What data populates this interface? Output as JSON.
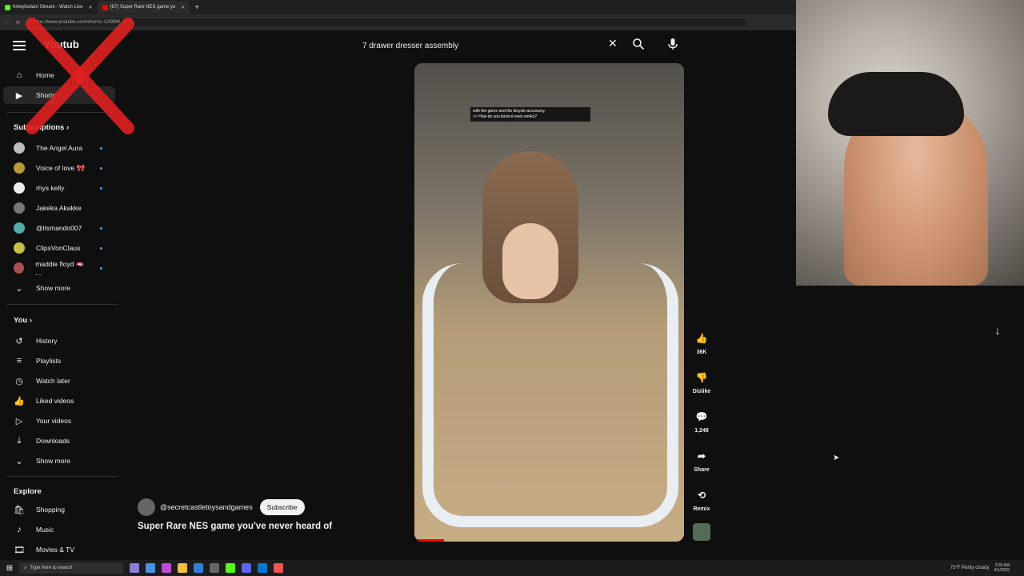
{
  "browser": {
    "tabs": [
      {
        "label": "hiheyitsdani Stream - Watch Live",
        "color": "#53fc18"
      },
      {
        "label": "(67) Super Rare NES game yo",
        "color": "#ff0000"
      }
    ],
    "url": "https://www.youtube.com/shorts/-1Jr99W_xg"
  },
  "header": {
    "logo": "Youtub",
    "search_value": "7 drawer dresser assembly"
  },
  "sidebar": {
    "top": [
      {
        "label": "Home",
        "icon": "home-icon"
      },
      {
        "label": "Shorts",
        "icon": "shorts-icon"
      }
    ],
    "subscriptions_title": "Subscriptions",
    "subscriptions": [
      {
        "label": "The Angel Aura",
        "color": "#bdbdbd"
      },
      {
        "label": "Voice of love 🎀",
        "color": "#b89a3a"
      },
      {
        "label": "rhys kelly",
        "color": "#eeeeee"
      },
      {
        "label": "Jakeka Akakke",
        "color": "#777777"
      },
      {
        "label": "@itsmando007",
        "color": "#5aa"
      },
      {
        "label": "ClipsVonClaus",
        "color": "#c9c04a"
      },
      {
        "label": "maddie floyd 🫦 ...",
        "color": "#a85050"
      }
    ],
    "show_more": "Show more",
    "you_title": "You",
    "you_items": [
      {
        "label": "History",
        "icon": "history-icon"
      },
      {
        "label": "Playlists",
        "icon": "playlists-icon"
      },
      {
        "label": "Watch later",
        "icon": "watch-later-icon"
      },
      {
        "label": "Liked videos",
        "icon": "like-icon"
      },
      {
        "label": "Your videos",
        "icon": "play-icon"
      },
      {
        "label": "Downloads",
        "icon": "download-icon"
      }
    ],
    "show_more_2": "Show more",
    "explore_title": "Explore",
    "explore_items": [
      {
        "label": "Shopping",
        "icon": "shopping-icon"
      },
      {
        "label": "Music",
        "icon": "music-icon"
      },
      {
        "label": "Movies & TV",
        "icon": "movies-icon"
      }
    ]
  },
  "video": {
    "caption_line1": "with the game and the bicycle accessory.",
    "caption_line2": ">> How do you know it even works?",
    "progress": 0.11
  },
  "actions": {
    "likes": "36K",
    "dislike": "Dislike",
    "comments": "1,248",
    "share": "Share",
    "remix": "Remix"
  },
  "channel": {
    "handle": "@secretcastletoysandgames",
    "subscribe": "Subscribe",
    "title": "Super Rare NES game you've never heard of"
  },
  "taskbar": {
    "search_placeholder": "Type here to search",
    "weather": "73°F  Partly cloudy",
    "time": "2:00 AM",
    "date": "4/1/2025"
  }
}
